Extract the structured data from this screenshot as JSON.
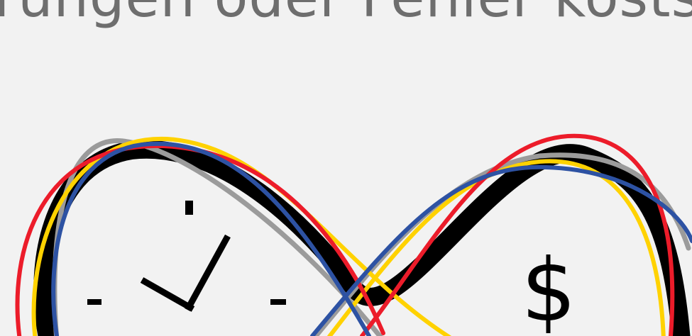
{
  "headline": {
    "text": "rungen oder Fehler kostspi"
  },
  "illustration": {
    "currency_symbol": "$",
    "icons": [
      "clock-icon",
      "dollar-icon"
    ],
    "line_colors": {
      "black": "#000000",
      "gray": "#9b9b9b",
      "yellow": "#ffd200",
      "red": "#ec1c2a",
      "blue": "#2d52a3"
    },
    "headline_color": "#6e6e6e",
    "background": "#f2f2f2"
  }
}
